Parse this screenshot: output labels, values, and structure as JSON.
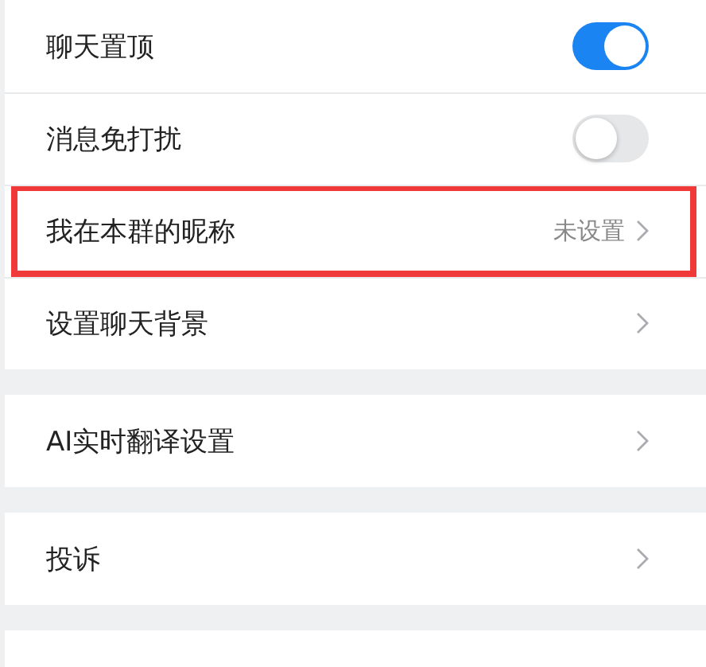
{
  "groups": [
    {
      "items": [
        {
          "kind": "toggle",
          "label": "聊天置顶",
          "on": true,
          "highlighted": false
        },
        {
          "kind": "toggle",
          "label": "消息免打扰",
          "on": false,
          "highlighted": false
        },
        {
          "kind": "link",
          "label": "我在本群的昵称",
          "value": "未设置",
          "highlighted": true
        },
        {
          "kind": "link",
          "label": "设置聊天背景",
          "highlighted": false
        }
      ]
    },
    {
      "items": [
        {
          "kind": "link",
          "label": "AI实时翻译设置",
          "highlighted": false
        }
      ]
    },
    {
      "items": [
        {
          "kind": "link",
          "label": "投诉",
          "highlighted": false
        }
      ]
    }
  ]
}
